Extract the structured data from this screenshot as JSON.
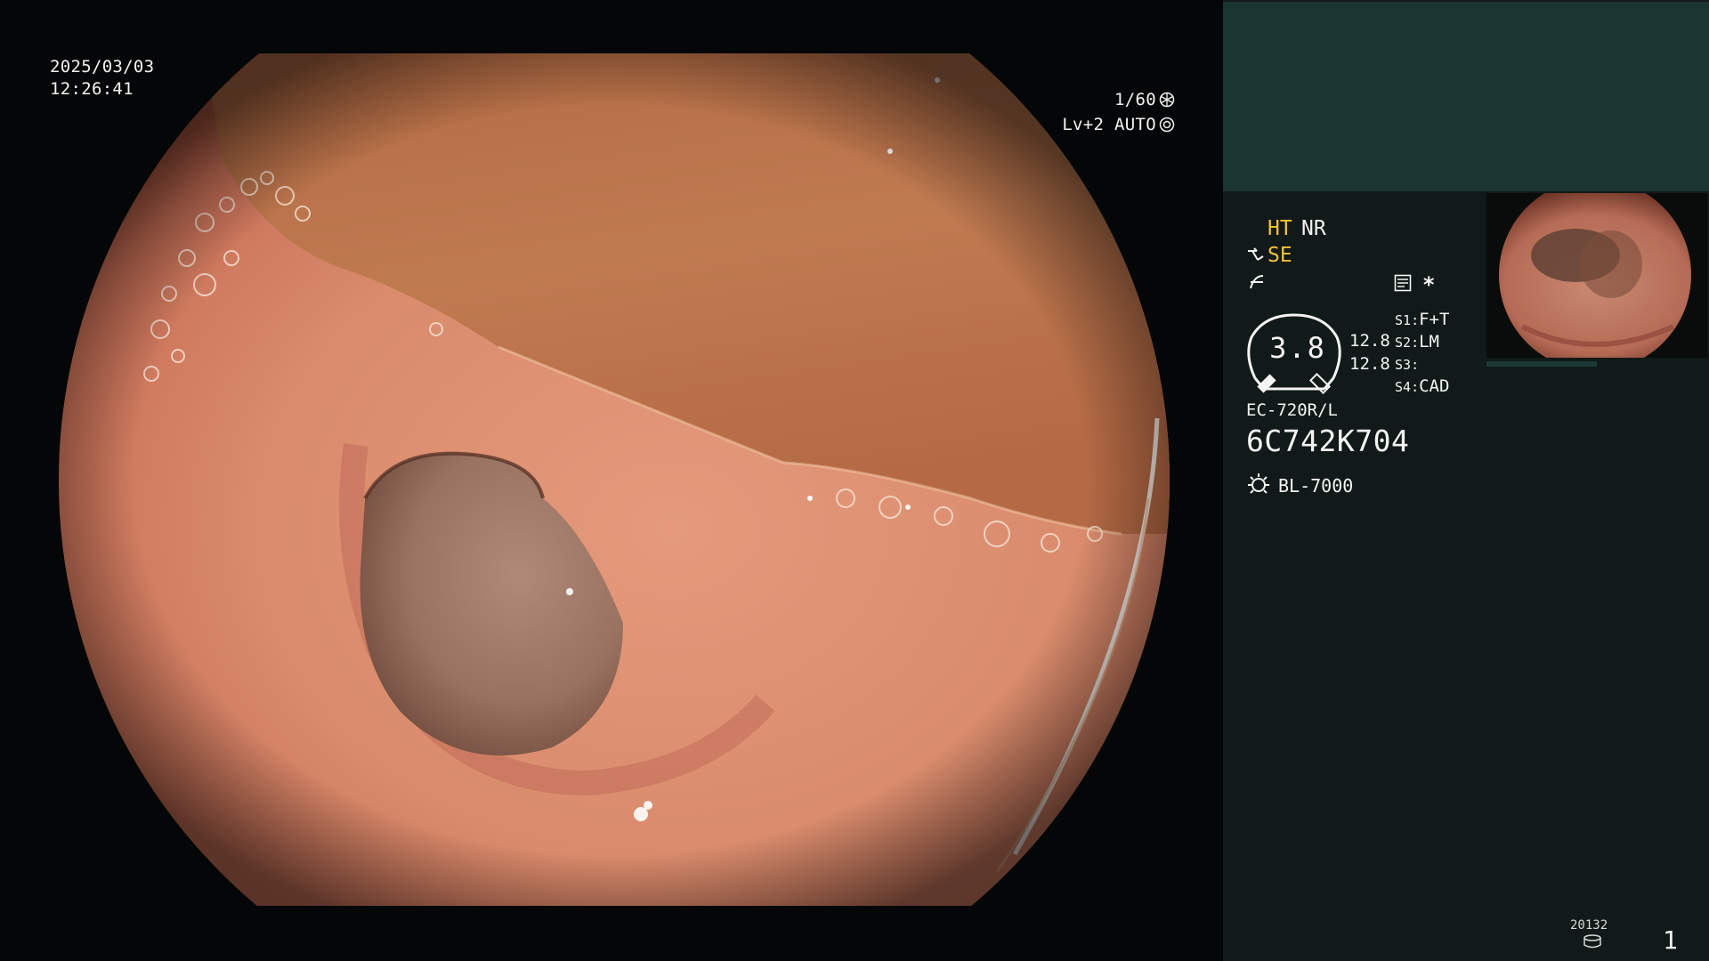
{
  "overlay": {
    "date": "2025/03/03",
    "time": "12:26:41",
    "shutter": "1/60",
    "level": "Lv+2",
    "exposure_mode": "AUTO",
    "shutter_icon": "aperture-icon",
    "mode_icon": "iris-icon"
  },
  "panel": {
    "ht": "HT",
    "nr": "NR",
    "se": "SE",
    "se_icon": "scope-icon",
    "enhance_icon": "enhancement-icon",
    "settings_icon": "document-settings-icon",
    "asterisk": "*",
    "dial_value": "3.8",
    "values": [
      "12.8",
      "12.8"
    ],
    "switches": [
      {
        "key": "S1",
        "label": "F+T"
      },
      {
        "key": "S2",
        "label": "LM"
      },
      {
        "key": "S3",
        "label": ""
      },
      {
        "key": "S4",
        "label": "CAD"
      }
    ],
    "scope_model": "EC-720R/L",
    "serial": "6C742K704",
    "light_source": "BL-7000",
    "light_icon": "light-source-icon",
    "counter": "20132",
    "storage_icon": "storage-icon",
    "page": "1"
  },
  "colors": {
    "panel_bg": "#111a18",
    "panel_top": "#1b3532",
    "accent_yellow": "#f4c23b",
    "text": "#ffffff"
  }
}
